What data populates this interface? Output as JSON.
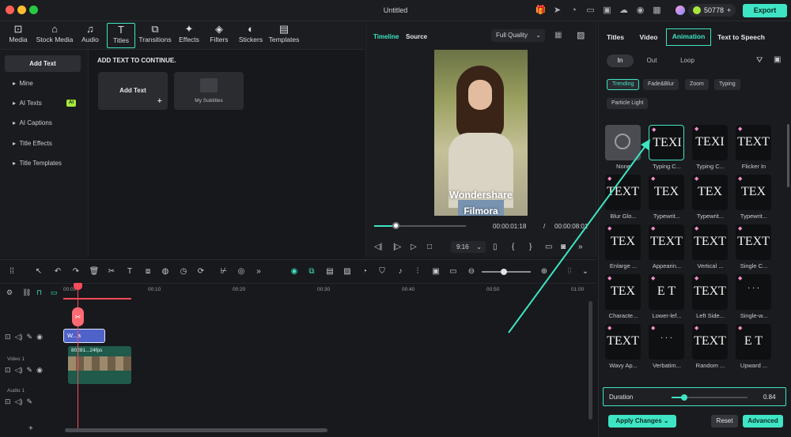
{
  "window": {
    "title": "Untitled",
    "credits": "50778",
    "export_label": "Export"
  },
  "media_tabs": [
    {
      "label": "Media"
    },
    {
      "label": "Stock Media"
    },
    {
      "label": "Audio"
    },
    {
      "label": "Titles"
    },
    {
      "label": "Transitions"
    },
    {
      "label": "Effects"
    },
    {
      "label": "Filters"
    },
    {
      "label": "Stickers"
    },
    {
      "label": "Templates"
    }
  ],
  "left_nav": [
    {
      "label": "Add Text"
    },
    {
      "label": "Mine"
    },
    {
      "label": "AI Texts",
      "badge": "AI"
    },
    {
      "label": "AI Captions"
    },
    {
      "label": "Title Effects"
    },
    {
      "label": "Title Templates"
    }
  ],
  "content": {
    "heading": "ADD TEXT TO CONTINUE.",
    "cards": [
      {
        "label": "Add Text"
      },
      {
        "label": "My Subtitles"
      }
    ]
  },
  "player": {
    "tab_timeline": "Timeline",
    "tab_source": "Source",
    "quality": "Full Quality",
    "overlay_line1": "Wondershare",
    "overlay_line2": "Filmora",
    "current_time": "00:00:01:18",
    "separator": "/",
    "total_time": "00:00:08:01",
    "ratio": "9:16",
    "progress": 0.23
  },
  "props": {
    "tabs": [
      {
        "label": "Titles"
      },
      {
        "label": "Video"
      },
      {
        "label": "Animation"
      },
      {
        "label": "Text to Speech"
      }
    ],
    "subtabs": [
      {
        "label": "In"
      },
      {
        "label": "Out"
      },
      {
        "label": "Loop"
      }
    ],
    "chips": [
      {
        "label": "Trending"
      },
      {
        "label": "Fade&Blur"
      },
      {
        "label": "Zoom"
      },
      {
        "label": "Typing"
      },
      {
        "label": "Particle Light"
      }
    ],
    "presets": [
      {
        "label": "None",
        "glyph": ""
      },
      {
        "label": "Typing C...",
        "glyph": "TEXI"
      },
      {
        "label": "Typing C...",
        "glyph": "TEXI"
      },
      {
        "label": "Flicker In",
        "glyph": "TEXT"
      },
      {
        "label": "Blur Glo...",
        "glyph": "TEXT"
      },
      {
        "label": "Typewrit...",
        "glyph": "TEX"
      },
      {
        "label": "Typewrit...",
        "glyph": "TEX"
      },
      {
        "label": "Typewrit...",
        "glyph": "TEX"
      },
      {
        "label": "Enlarge ...",
        "glyph": "TEX"
      },
      {
        "label": "Appearin...",
        "glyph": "TEXT"
      },
      {
        "label": "Vertical ...",
        "glyph": "TEXT"
      },
      {
        "label": "Single C...",
        "glyph": "TEXT"
      },
      {
        "label": "Characte...",
        "glyph": "TEX"
      },
      {
        "label": "Lower-lef...",
        "glyph": "E T"
      },
      {
        "label": "Left Side...",
        "glyph": "TEXT"
      },
      {
        "label": "Single-w...",
        "glyph": "· · ·"
      },
      {
        "label": "Wavy Ap...",
        "glyph": "TEXT"
      },
      {
        "label": "Verbatim...",
        "glyph": "· · ·"
      },
      {
        "label": "Random ...",
        "glyph": "TEXT"
      },
      {
        "label": "Upward ...",
        "glyph": "E T"
      }
    ],
    "duration_label": "Duration",
    "duration_value": "0.84",
    "duration_fraction": 0.17,
    "apply_label": "Apply Changes",
    "reset_label": "Reset",
    "advanced_label": "Advanced"
  },
  "timeline": {
    "ruler": [
      "00:00",
      "00:10",
      "00:20",
      "00:30",
      "00:40",
      "00:50",
      "01:00"
    ],
    "video_track": "Video 1",
    "audio_track": "Audio 1",
    "title_clip": "W...a",
    "video_clip": "80281...24fps"
  },
  "colors": {
    "accent": "#3ee5c4",
    "playhead": "#ff4a5a",
    "lime": "#a8e83c"
  }
}
